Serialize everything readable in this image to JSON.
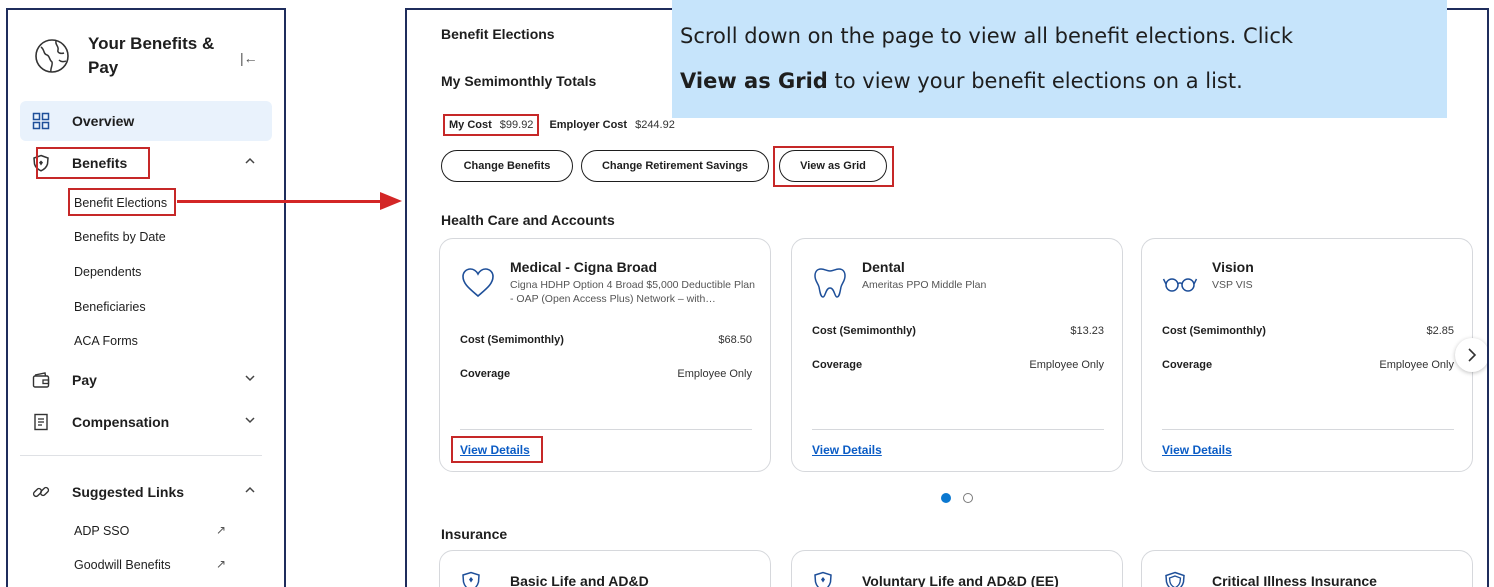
{
  "sidebar": {
    "title": "Your Benefits & Pay",
    "overview": "Overview",
    "benefits": "Benefits",
    "benefits_sub": [
      "Benefit Elections",
      "Benefits by Date",
      "Dependents",
      "Beneficiaries",
      "ACA Forms"
    ],
    "pay": "Pay",
    "compensation": "Compensation",
    "suggested_links": "Suggested Links",
    "links": [
      "ADP SSO",
      "Goodwill Benefits"
    ]
  },
  "main": {
    "title": "Benefit Elections",
    "totals_heading": "My Semimonthly Totals",
    "my_cost_label": "My Cost",
    "my_cost_value": "$99.92",
    "employer_cost_label": "Employer Cost",
    "employer_cost_value": "$244.92",
    "buttons": {
      "change_benefits": "Change Benefits",
      "change_retirement": "Change Retirement Savings",
      "view_as_grid": "View as Grid"
    },
    "health_heading": "Health Care and Accounts",
    "cards": [
      {
        "title": "Medical - Cigna Broad",
        "desc": "Cigna HDHP Option 4 Broad $5,000 Deductible Plan - OAP (Open Access Plus) Network – with…",
        "cost_label": "Cost (Semimonthly)",
        "cost": "$68.50",
        "coverage_label": "Coverage",
        "coverage": "Employee Only",
        "link": "View Details"
      },
      {
        "title": "Dental",
        "desc": "Ameritas PPO Middle Plan",
        "cost_label": "Cost (Semimonthly)",
        "cost": "$13.23",
        "coverage_label": "Coverage",
        "coverage": "Employee Only",
        "link": "View Details"
      },
      {
        "title": "Vision",
        "desc": "VSP VIS",
        "cost_label": "Cost (Semimonthly)",
        "cost": "$2.85",
        "coverage_label": "Coverage",
        "coverage": "Employee Only",
        "link": "View Details"
      }
    ],
    "carousel_page": 1,
    "carousel_pages": 2,
    "insurance_heading": "Insurance",
    "insurance_cards": [
      "Basic Life and AD&D",
      "Voluntary Life and AD&D (EE)",
      "Critical Illness Insurance"
    ]
  },
  "callout": {
    "line1_pre": "Scroll down on the page to view all benefit elections. Click",
    "line2_bold": "View as Grid",
    "line2_rest": " to view your benefit elections on a list."
  },
  "colors": {
    "highlight": "#c62828",
    "callout_bg": "#c6e4fb",
    "link": "#0b5cc5",
    "panel_border": "#1f2d5c"
  }
}
